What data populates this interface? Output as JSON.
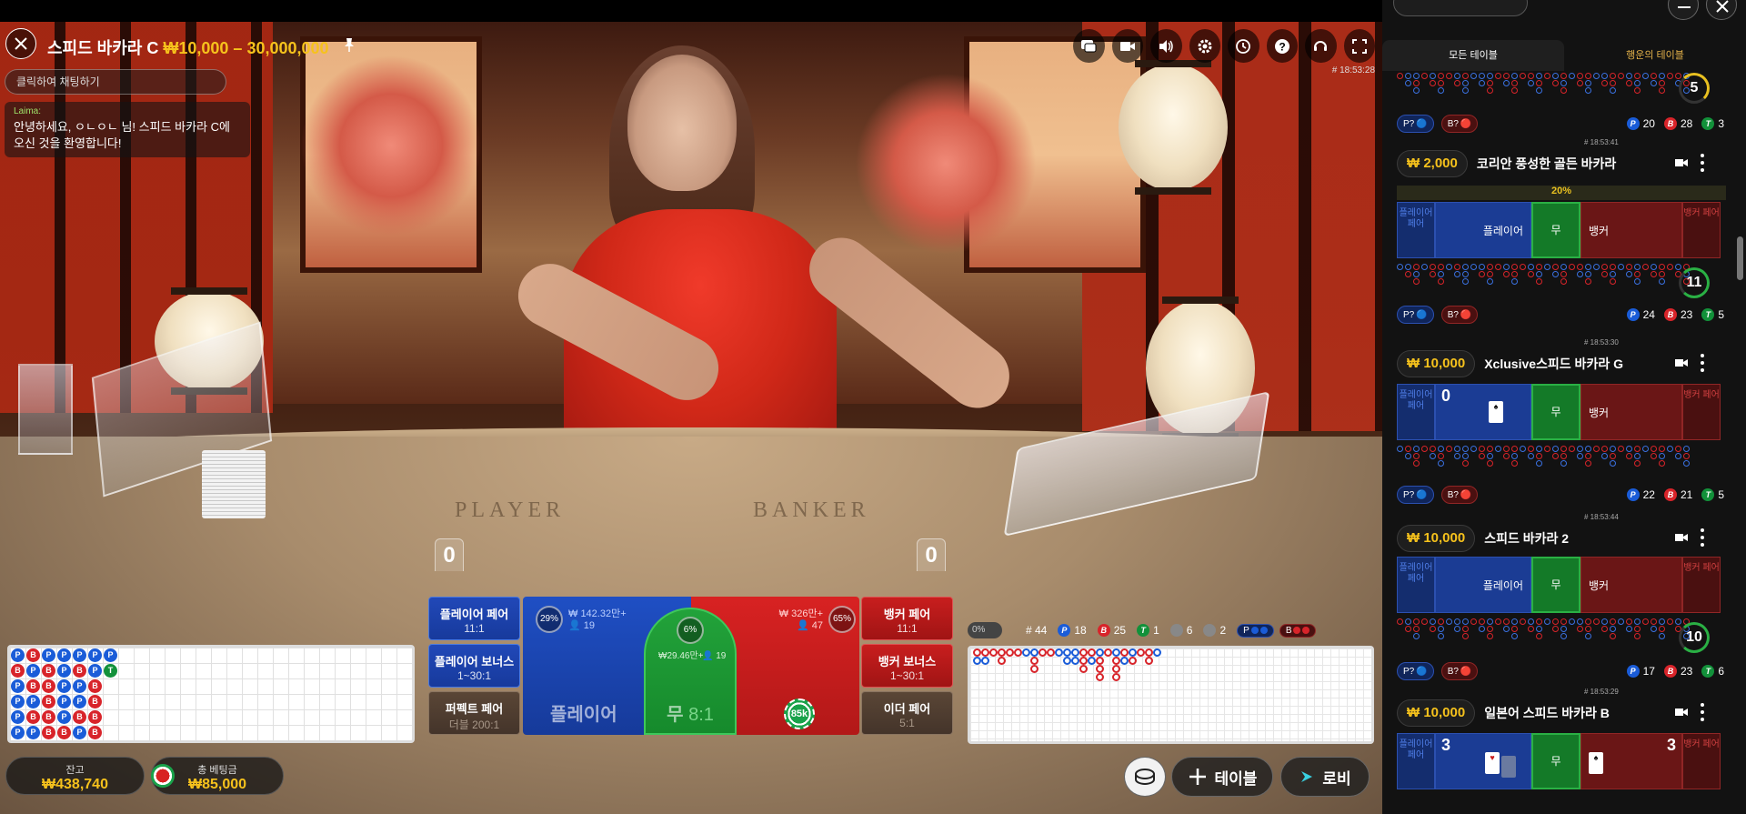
{
  "table": {
    "title": "스피드 바카라 C",
    "limits": "₩10,000 – 30,000,000",
    "time": "# 18:53:28",
    "felt_player": "PLAYER",
    "felt_banker": "BANKER",
    "player_score": "0",
    "banker_score": "0"
  },
  "chat": {
    "placeholder": "클릭하여 채팅하기",
    "author": "Laima:",
    "message": "안녕하세요, ㅇㄴㅇㄴ 님! 스피드 바카라 C에 오신 것을 환영합니다!"
  },
  "toolbar": [
    "chat-icon",
    "video-icon",
    "volume-icon",
    "gear-icon",
    "history-icon",
    "help-icon",
    "support-icon",
    "fullscreen-icon"
  ],
  "bets": {
    "player_pair": {
      "label": "플레이어 페어",
      "odds": "11:1"
    },
    "player_bonus": {
      "label": "플레이어 보너스",
      "odds": "1~30:1"
    },
    "perfect_pair": {
      "label": "퍼펙트 페어",
      "odds": "더블 200:1"
    },
    "banker_pair": {
      "label": "뱅커 페어",
      "odds": "11:1"
    },
    "banker_bonus": {
      "label": "뱅커 보너스",
      "odds": "1~30:1"
    },
    "either_pair": {
      "label": "이더 페어",
      "odds": "5:1"
    },
    "player": {
      "label": "플레이어",
      "pct": "29%",
      "amount": "₩ 142.32만+",
      "bettors": "19"
    },
    "tie": {
      "label": "무",
      "odds": "8:1",
      "pct": "6%",
      "amount": "₩29.46만+",
      "bettors": "19"
    },
    "banker": {
      "label": "",
      "pct": "65%",
      "amount": "₩ 326만+",
      "bettors": "47"
    },
    "chip": "85k"
  },
  "stats": {
    "toggle": "0%",
    "round": "# 44",
    "p": "18",
    "b": "25",
    "t": "1",
    "pp": "6",
    "bp": "2",
    "p_pred": "P",
    "b_pred": "B"
  },
  "bead_road": [
    [
      "P",
      "B",
      "P",
      "P",
      "P",
      "P",
      "P"
    ],
    [
      "B",
      "P",
      "B",
      "P",
      "B",
      "P",
      "T"
    ],
    [
      "P",
      "B",
      "B",
      "P",
      "P",
      "B",
      ""
    ],
    [
      "P",
      "P",
      "B",
      "P",
      "P",
      "B",
      ""
    ],
    [
      "P",
      "B",
      "B",
      "P",
      "B",
      "B",
      ""
    ],
    [
      "P",
      "P",
      "B",
      "B",
      "P",
      "B",
      ""
    ]
  ],
  "balance": {
    "label": "잔고",
    "value": "₩438,740"
  },
  "total_bet": {
    "label": "총 베팅금",
    "value": "₩85,000"
  },
  "bottom_buttons": {
    "table": "테이블",
    "lobby": "로비"
  },
  "lobby": {
    "tabs": [
      "모든 테이블",
      "행운의 테이블"
    ],
    "first_footer": {
      "timer": "5",
      "p": "20",
      "b": "28",
      "t": "3"
    },
    "cards": [
      {
        "time": "# 18:53:41",
        "limit": "₩ 2,000",
        "name": "코리안 풍성한 골든 바카라",
        "pct": "20%",
        "pp": "플레이어 페어",
        "player": "플레이어",
        "tie": "무",
        "banker": "뱅커",
        "bp": "뱅커 페어",
        "timer": "11",
        "p": "24",
        "b": "23",
        "t": "5"
      },
      {
        "time": "# 18:53:30",
        "limit": "₩ 10,000",
        "name": "Xclusive스피드 바카라 G",
        "pp": "플레이어 페어",
        "player_num": "0",
        "tie": "무",
        "banker": "뱅커",
        "bp": "뱅커 페어",
        "p": "22",
        "b": "21",
        "t": "5"
      },
      {
        "time": "# 18:53:44",
        "limit": "₩ 10,000",
        "name": "스피드 바카라 2",
        "pp": "플레이어 페어",
        "player": "플레이어",
        "tie": "무",
        "banker": "뱅커",
        "bp": "뱅커 페어",
        "timer": "10",
        "p": "17",
        "b": "23",
        "t": "6"
      },
      {
        "time": "# 18:53:29",
        "limit": "₩ 10,000",
        "name": "일본어 스피드 바카라 B",
        "pp": "플레이어 페어",
        "player_num": "3",
        "tie": "무",
        "banker_num": "3",
        "bp": "뱅커 페어"
      }
    ],
    "pred_p": "P?",
    "pred_b": "B?"
  },
  "colors": {
    "gold": "#f6c21c",
    "player": "#1a5cd8",
    "banker": "#d8242a",
    "tie": "#12913a"
  }
}
